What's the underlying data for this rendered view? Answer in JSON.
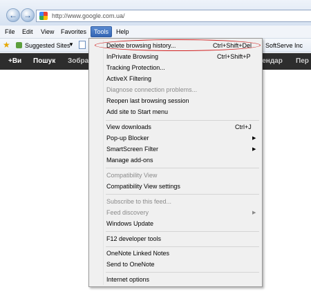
{
  "window": {
    "url": "http://www.google.com.ua/"
  },
  "menubar": {
    "items": [
      "File",
      "Edit",
      "View",
      "Favorites",
      "Tools",
      "Help"
    ]
  },
  "favorites_bar": {
    "suggested_sites": "Suggested Sites",
    "softserve": "SoftServe Inc"
  },
  "google_bar": {
    "items": [
      "+Ви",
      "Пошук",
      "Зобра",
      "лендар",
      "Пер"
    ]
  },
  "tools_menu": {
    "delete_history": {
      "label": "Delete browsing history...",
      "shortcut": "Ctrl+Shift+Del"
    },
    "inprivate": {
      "label": "InPrivate Browsing",
      "shortcut": "Ctrl+Shift+P"
    },
    "tracking_protection": {
      "label": "Tracking Protection..."
    },
    "activex": {
      "label": "ActiveX Filtering"
    },
    "diagnose": {
      "label": "Diagnose connection problems..."
    },
    "reopen_session": {
      "label": "Reopen last browsing session"
    },
    "add_site": {
      "label": "Add site to Start menu"
    },
    "view_downloads": {
      "label": "View downloads",
      "shortcut": "Ctrl+J"
    },
    "popup_blocker": {
      "label": "Pop-up Blocker"
    },
    "smartscreen": {
      "label": "SmartScreen Filter"
    },
    "manage_addons": {
      "label": "Manage add-ons"
    },
    "compat_view": {
      "label": "Compatibility View"
    },
    "compat_settings": {
      "label": "Compatibility View settings"
    },
    "subscribe_feed": {
      "label": "Subscribe to this feed..."
    },
    "feed_discovery": {
      "label": "Feed discovery"
    },
    "windows_update": {
      "label": "Windows Update"
    },
    "f12_tools": {
      "label": "F12 developer tools"
    },
    "onenote_linked": {
      "label": "OneNote Linked Notes"
    },
    "send_onenote": {
      "label": "Send to OneNote"
    },
    "internet_options": {
      "label": "Internet options"
    }
  },
  "colors": {
    "highlight_ellipse": "#d12020",
    "tools_active": "#3465b4",
    "google_bar": "#2d2d2d"
  }
}
